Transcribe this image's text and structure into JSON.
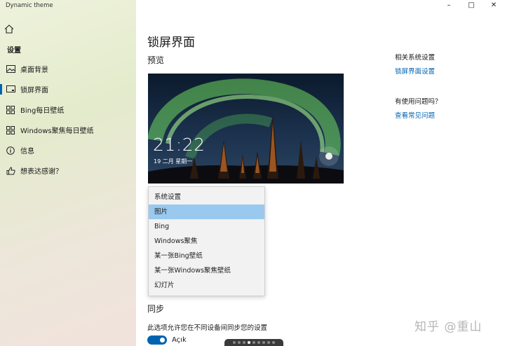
{
  "app": {
    "title": "Dynamic theme"
  },
  "sidebar": {
    "heading": "设置",
    "items": [
      {
        "label": "桌面背景",
        "icon": "image-icon",
        "active": false
      },
      {
        "label": "锁屏界面",
        "icon": "lockscreen-icon",
        "active": true
      },
      {
        "label": "Bing每日壁纸",
        "icon": "grid-icon",
        "active": false
      },
      {
        "label": "Windows聚焦每日壁纸",
        "icon": "grid-icon",
        "active": false
      },
      {
        "label": "信息",
        "icon": "info-icon",
        "active": false
      },
      {
        "label": "想表达感谢？",
        "icon": "thumbs-up-icon",
        "active": false
      }
    ]
  },
  "main": {
    "title": "锁屏界面",
    "preview_heading": "预览",
    "preview": {
      "time": "21:22",
      "date": "19 二月 星期一"
    },
    "dropdown": {
      "selected_index": 1,
      "options": [
        "系统设置",
        "图片",
        "Bing",
        "Windows聚焦",
        "某一张Bing壁纸",
        "某一张Windows聚焦壁纸",
        "幻灯片"
      ]
    },
    "sync": {
      "heading": "同步",
      "description": "此选项允许您在不同设备间同步您的设置",
      "toggle_label": "Açık",
      "toggle_on": true
    },
    "pager": {
      "count": 9,
      "current": 4
    }
  },
  "related": {
    "heading": "相关系统设置",
    "link": "锁屏界面设置"
  },
  "help": {
    "heading": "有使用问题吗？",
    "link": "查看常见问题"
  },
  "watermark": "知乎 @重山",
  "colors": {
    "accent": "#0063b1",
    "selection": "#99c9ee"
  }
}
